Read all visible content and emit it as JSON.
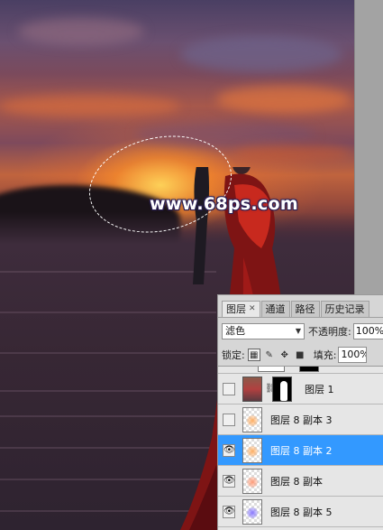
{
  "canvas": {
    "watermark": "www.68ps.com"
  },
  "layers_panel": {
    "tabs": [
      {
        "label": "图层",
        "active": true,
        "closable": true
      },
      {
        "label": "通道",
        "active": false
      },
      {
        "label": "路径",
        "active": false
      },
      {
        "label": "历史记录",
        "active": false
      }
    ],
    "blend_mode": "滤色",
    "opacity_label": "不透明度:",
    "opacity_value": "100%",
    "lock_label": "锁定:",
    "fill_label": "填充:",
    "fill_value": "100%",
    "layers": [
      {
        "name": "图层 1",
        "visible": false,
        "selected": false,
        "thumb": "photo-with-mask"
      },
      {
        "name": "图层 8 副本 3",
        "visible": false,
        "selected": false,
        "thumb": "orange-blob"
      },
      {
        "name": "图层 8 副本 2",
        "visible": true,
        "selected": true,
        "thumb": "orange-blob"
      },
      {
        "name": "图层 8 副本",
        "visible": true,
        "selected": false,
        "thumb": "orange-blob"
      },
      {
        "name": "图层 8 副本 5",
        "visible": true,
        "selected": false,
        "thumb": "blue-blob"
      }
    ],
    "colors": {
      "selected_row": "#3399ff",
      "panel_bg": "#d6d6d6"
    }
  }
}
